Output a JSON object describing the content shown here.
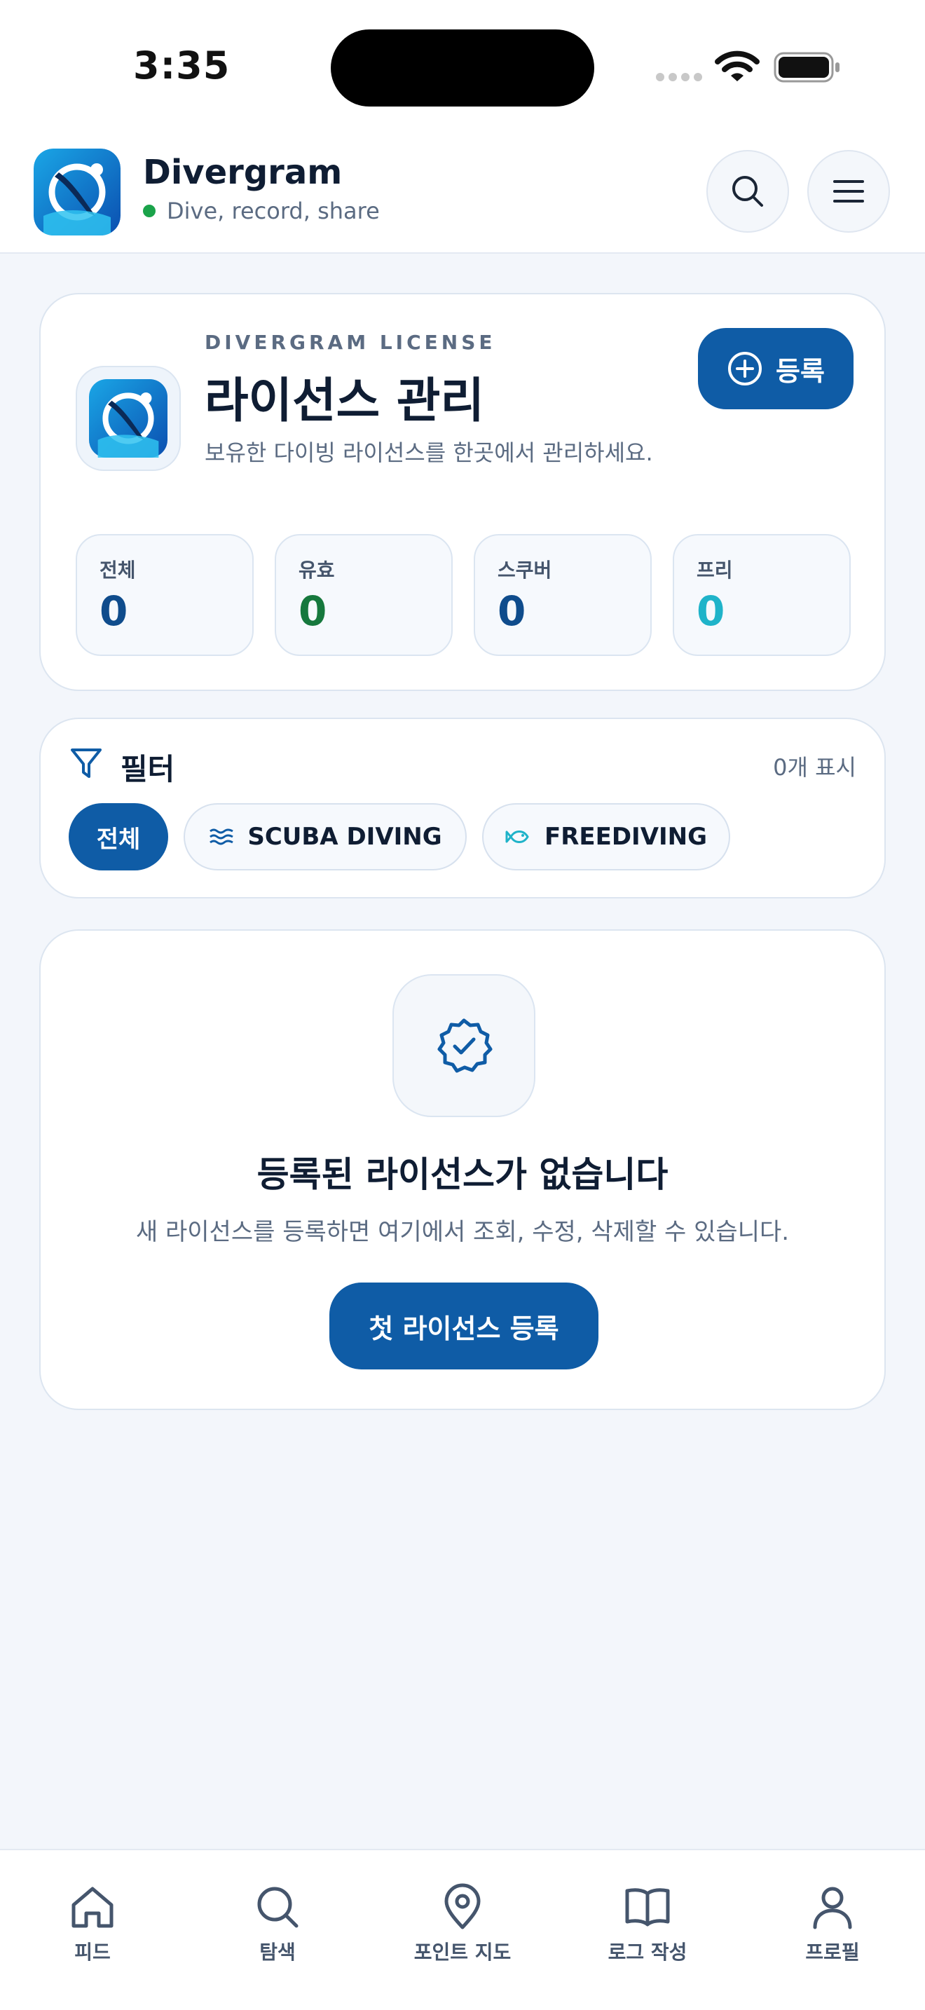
{
  "status_bar": {
    "time": "3:35"
  },
  "header": {
    "app_name": "Divergram",
    "tagline": "Dive, record, share",
    "icons": [
      "search-icon",
      "menu-icon"
    ]
  },
  "license_card": {
    "eyebrow": "DIVERGRAM LICENSE",
    "title": "라이선스 관리",
    "description": "보유한 다이빙 라이선스를 한곳에서 관리하세요.",
    "register_label": "등록",
    "stats": [
      {
        "label": "전체",
        "value": "0",
        "color": "#0f4c8c"
      },
      {
        "label": "유효",
        "value": "0",
        "color": "#16783d"
      },
      {
        "label": "스쿠버",
        "value": "0",
        "color": "#0f4c8c"
      },
      {
        "label": "프리",
        "value": "0",
        "color": "#1fb3c9"
      }
    ]
  },
  "filter": {
    "title": "필터",
    "count": "0개 표시",
    "chips": [
      {
        "label": "전체",
        "selected": true
      },
      {
        "label": "SCUBA DIVING",
        "icon": "waves-icon"
      },
      {
        "label": "FREEDIVING",
        "icon": "fish-icon"
      }
    ]
  },
  "empty_state": {
    "title": "등록된 라이선스가 없습니다",
    "description": "새 라이선스를 등록하면 여기에서 조회, 수정, 삭제할 수 있습니다.",
    "button_label": "첫 라이선스 등록"
  },
  "bottom_nav": [
    {
      "label": "피드",
      "icon": "home-icon"
    },
    {
      "label": "탐색",
      "icon": "search-icon"
    },
    {
      "label": "포인트 지도",
      "icon": "map-pin-icon"
    },
    {
      "label": "로그 작성",
      "icon": "book-icon"
    },
    {
      "label": "프로필",
      "icon": "user-icon"
    }
  ],
  "colors": {
    "primary": "#0f5ca6",
    "text": "#0f1d33",
    "muted": "#5b6b82",
    "online": "#1aa34a"
  }
}
